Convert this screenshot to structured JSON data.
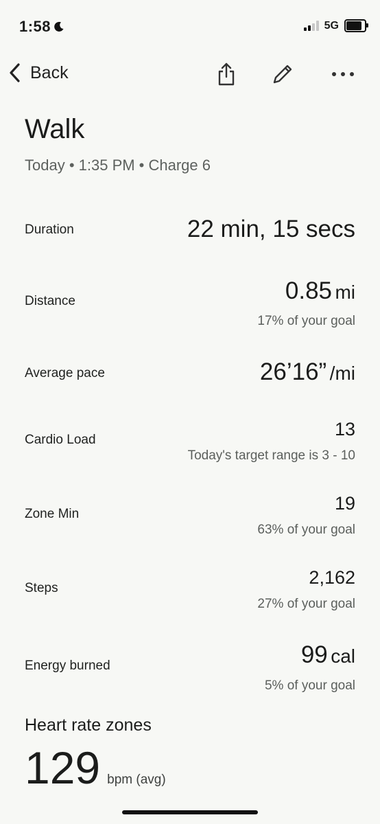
{
  "status_bar": {
    "time": "1:58",
    "network": "5G"
  },
  "nav": {
    "back_label": "Back"
  },
  "header": {
    "title": "Walk",
    "subtitle": "Today • 1:35 PM • Charge 6"
  },
  "metrics": {
    "duration": {
      "label": "Duration",
      "value": "22 min, 15 secs"
    },
    "distance": {
      "label": "Distance",
      "value": "0.85",
      "unit": "mi",
      "sub": "17% of your goal"
    },
    "pace": {
      "label": "Average pace",
      "value": "26’16”",
      "unit": "/mi"
    },
    "cardio": {
      "label": "Cardio Load",
      "value": "13",
      "sub": "Today's target range is 3 - 10"
    },
    "zone": {
      "label": "Zone Min",
      "value": "19",
      "sub": "63% of your goal"
    },
    "steps": {
      "label": "Steps",
      "value": "2,162",
      "sub": "27% of your goal"
    },
    "energy": {
      "label": "Energy burned",
      "value": "99",
      "unit": "cal",
      "sub": "5% of your goal"
    }
  },
  "heart_rate": {
    "title": "Heart rate zones",
    "value": "129",
    "unit": "bpm (avg)"
  },
  "icons": {
    "back": "chevron-left-icon",
    "share": "share-icon",
    "edit": "pencil-icon",
    "more": "more-horizontal-icon"
  }
}
